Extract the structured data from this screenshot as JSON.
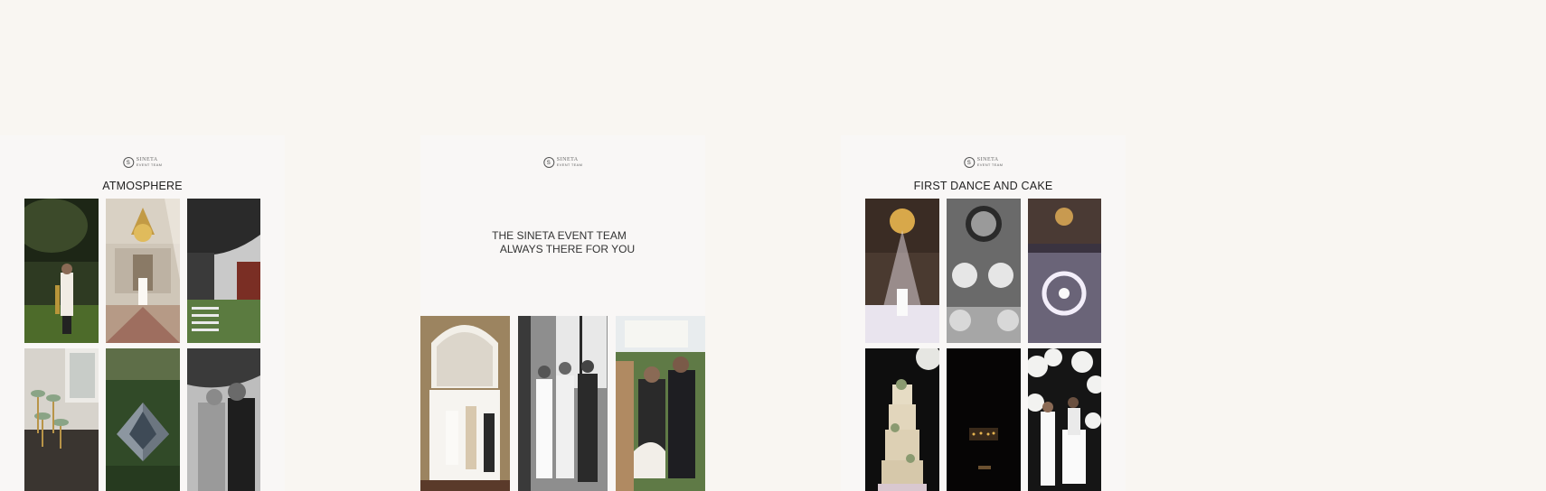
{
  "brand": {
    "logo_mark": "S",
    "logo_name": "SINETA",
    "logo_sub": "EVENT TEAM"
  },
  "cards": [
    {
      "title": "ATMOSPHERE",
      "photos": [
        "saxophonist-under-tree",
        "chandelier-ballroom-couple",
        "garden-ceremony-bw",
        "dessert-table-window",
        "aerial-palace-garden",
        "couple-embrace-bw"
      ]
    },
    {
      "tagline_line1": "THE SINETA EVENT TEAM",
      "tagline_line2": "ALWAYS THERE FOR YOU",
      "photos": [
        "ceremony-arched-window",
        "couple-vows-bw",
        "guests-seated-outdoors"
      ]
    },
    {
      "title": "FIRST DANCE AND CAKE",
      "photos": [
        "first-dance-chandelier",
        "floral-hall-bw",
        "light-ring-dance",
        "white-wedding-cake",
        "night-palace-lights",
        "cake-cutting-flowers"
      ]
    }
  ]
}
